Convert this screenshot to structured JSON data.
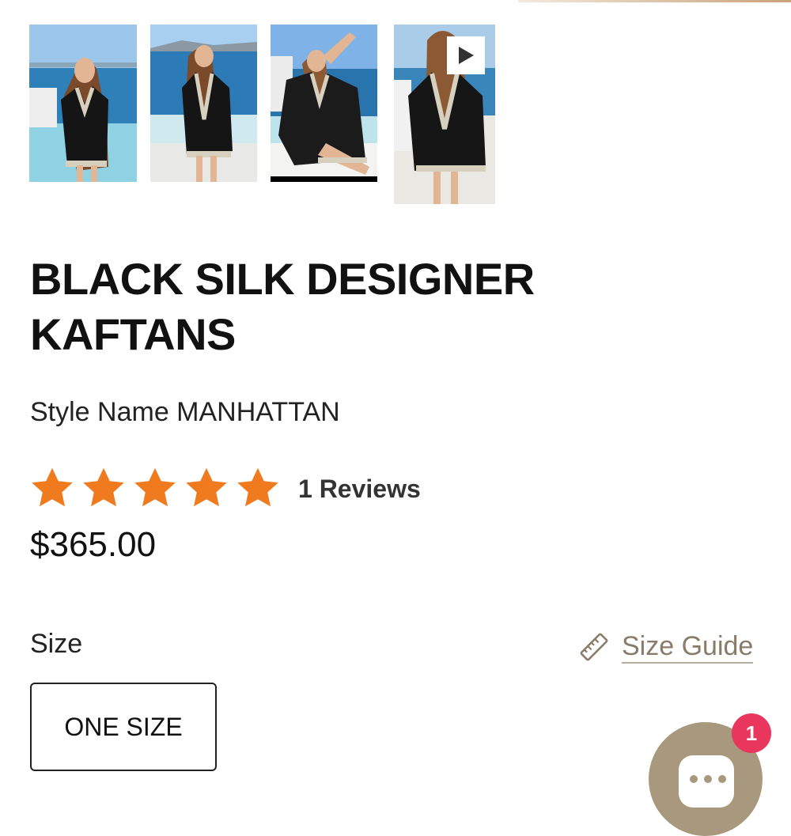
{
  "gallery": {
    "images": [
      {
        "name": "photo-front-pose"
      },
      {
        "name": "photo-back-view"
      },
      {
        "name": "photo-seated-pose"
      },
      {
        "name": "photo-back-video"
      }
    ],
    "active_index": 2,
    "video_icon": "play-icon"
  },
  "product": {
    "title": "BLACK SILK DESIGNER KAFTANS",
    "style_name": "Style Name MANHATTAN",
    "rating": 5,
    "rating_max": 5,
    "reviews_label": "1 Reviews",
    "price": "$365.00"
  },
  "size": {
    "label": "Size",
    "guide_label": "Size Guide",
    "guide_icon": "ruler-icon",
    "options": [
      "ONE SIZE"
    ]
  },
  "chat": {
    "icon": "chat-bubble-icon",
    "badge_count": "1"
  },
  "colors": {
    "star": "#f07a1e",
    "accent": "#a8987e",
    "badge": "#e8365d"
  }
}
